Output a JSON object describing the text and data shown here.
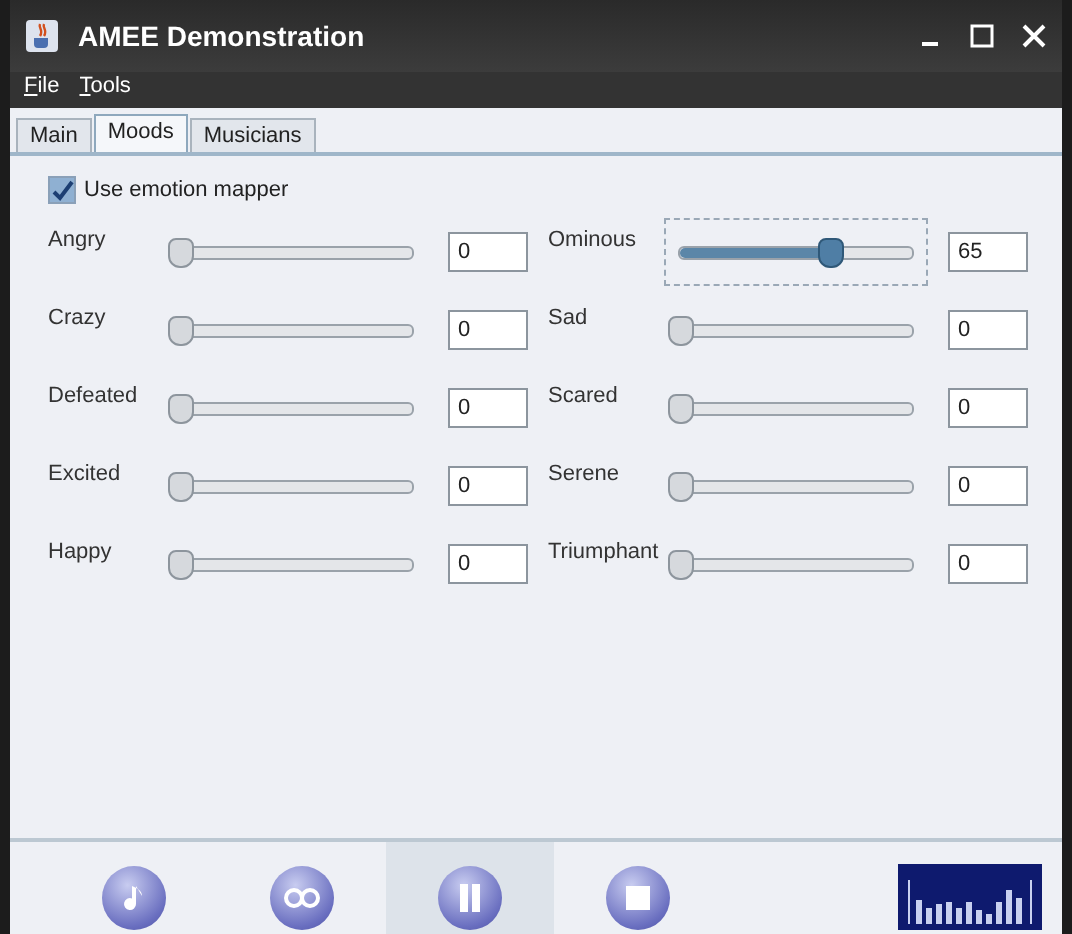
{
  "window": {
    "title": "AMEE Demonstration"
  },
  "menu": [
    {
      "label": "File"
    },
    {
      "label": "Tools"
    }
  ],
  "tabs": [
    {
      "label": "Main",
      "selected": false
    },
    {
      "label": "Moods",
      "selected": true
    },
    {
      "label": "Musicians",
      "selected": false
    }
  ],
  "use_emotion_mapper": {
    "label": "Use emotion mapper",
    "checked": true
  },
  "moods_left": [
    {
      "name": "Angry",
      "level": 0,
      "value": "0",
      "focused": false
    },
    {
      "name": "Crazy",
      "level": 0,
      "value": "0",
      "focused": false
    },
    {
      "name": "Defeated",
      "level": 0,
      "value": "0",
      "focused": false
    },
    {
      "name": "Excited",
      "level": 0,
      "value": "0",
      "focused": false
    },
    {
      "name": "Happy",
      "level": 0,
      "value": "0",
      "focused": false
    }
  ],
  "moods_right": [
    {
      "name": "Ominous",
      "level": 0.65,
      "value": "65",
      "focused": true
    },
    {
      "name": "Sad",
      "level": 0,
      "value": "0",
      "focused": false
    },
    {
      "name": "Scared",
      "level": 0,
      "value": "0",
      "focused": false
    },
    {
      "name": "Serene",
      "level": 0,
      "value": "0",
      "focused": false
    },
    {
      "name": "Triumphant",
      "level": 0,
      "value": "0",
      "focused": false
    }
  ],
  "player_buttons": [
    {
      "kind": "note",
      "selected": false
    },
    {
      "kind": "loop",
      "selected": false
    },
    {
      "kind": "pause",
      "selected": true
    },
    {
      "kind": "stop",
      "selected": false
    }
  ]
}
